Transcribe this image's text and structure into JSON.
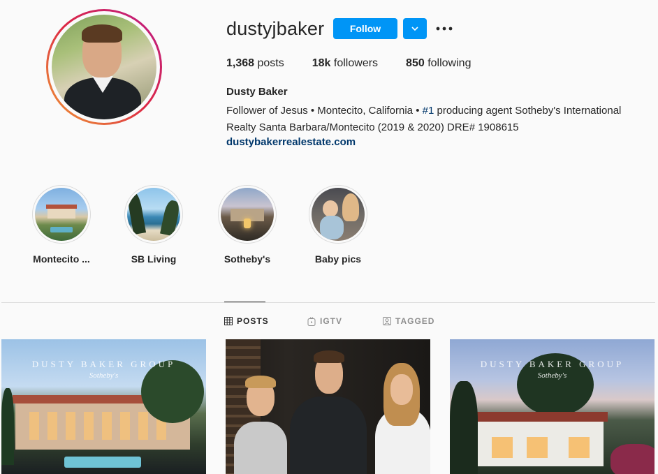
{
  "profile": {
    "username": "dustyjbaker",
    "follow_label": "Follow",
    "stats": {
      "posts_count": "1,368",
      "posts_label": "posts",
      "followers_count": "18k",
      "followers_label": "followers",
      "following_count": "850",
      "following_label": "following"
    },
    "full_name": "Dusty Baker",
    "bio_part1": "Follower of Jesus • Montecito, California • ",
    "bio_tag": "#1",
    "bio_part2": " producing agent Sotheby's International Realty Santa Barbara/Montecito (2019 & 2020) DRE# 1908615",
    "website": "dustybakerrealestate.com"
  },
  "highlights": [
    {
      "label": "Montecito ..."
    },
    {
      "label": "SB Living"
    },
    {
      "label": "Sotheby's"
    },
    {
      "label": "Baby pics"
    }
  ],
  "tabs": [
    {
      "label": "POSTS",
      "icon": "grid-icon",
      "active": true
    },
    {
      "label": "IGTV",
      "icon": "igtv-icon",
      "active": false
    },
    {
      "label": "TAGGED",
      "icon": "tagged-icon",
      "active": false
    }
  ],
  "posts": [
    {
      "overlay_title": "DUSTY BAKER GROUP",
      "overlay_sub": "Sotheby's"
    },
    {},
    {
      "overlay_title": "DUSTY BAKER GROUP",
      "overlay_sub": "Sotheby's"
    }
  ],
  "colors": {
    "accent": "#0095f6",
    "link": "#00376b",
    "text": "#262626",
    "muted": "#8e8e8e",
    "background": "#fafafa"
  }
}
